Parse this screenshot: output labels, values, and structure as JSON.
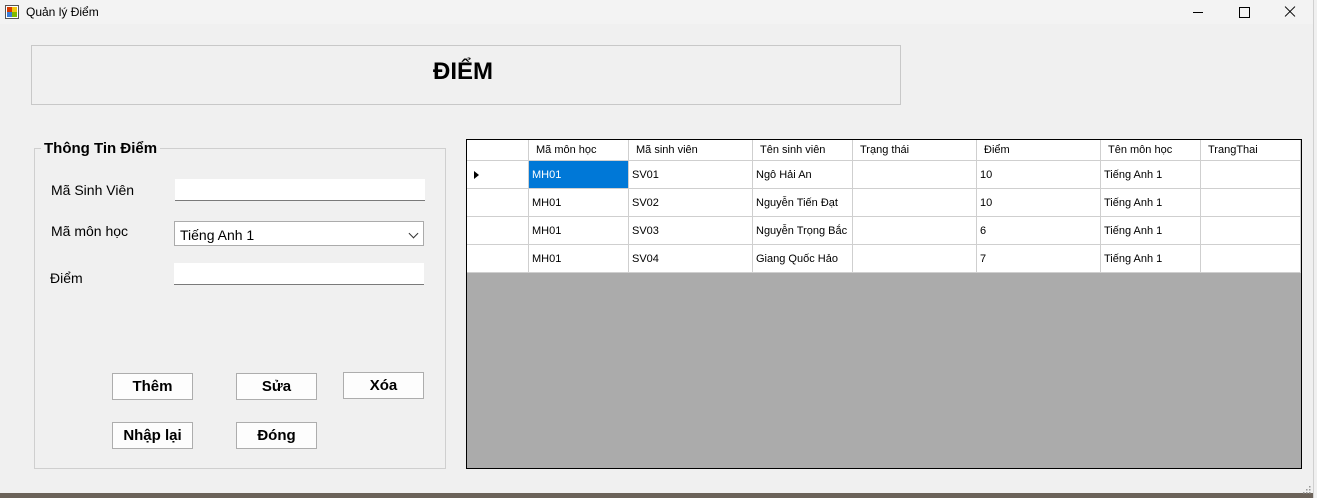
{
  "window": {
    "title": "Quản lý Điểm",
    "controls": {
      "minimize": "minimize",
      "maximize": "maximize",
      "close": "close"
    }
  },
  "header": {
    "title": "ĐIỂM"
  },
  "form": {
    "legend": "Thông Tin Điểm",
    "student_id_label": "Mã Sinh Viên",
    "student_id_value": "",
    "course_id_label": "Mã môn học",
    "course_selected": "Tiếng Anh 1",
    "score_label": "Điểm",
    "score_value": ""
  },
  "buttons": {
    "add": "Thêm",
    "edit": "Sửa",
    "delete": "Xóa",
    "reset": "Nhập lại",
    "close": "Đóng"
  },
  "grid": {
    "columns": [
      "Mã môn học",
      "Mã sinh viên",
      "Tên sinh viên",
      "Trạng thái",
      "Điểm",
      "Tên môn học",
      "TrangThai"
    ],
    "rows": [
      [
        "MH01",
        "SV01",
        "Ngô Hải An",
        "",
        "10",
        "Tiếng Anh 1",
        ""
      ],
      [
        "MH01",
        "SV02",
        "Nguyễn Tiến Đạt",
        "",
        "10",
        "Tiếng Anh 1",
        ""
      ],
      [
        "MH01",
        "SV03",
        "Nguyễn Trọng Bắc",
        "",
        "6",
        "Tiếng Anh 1",
        ""
      ],
      [
        "MH01",
        "SV04",
        "Giang Quốc Hảo",
        "",
        "7",
        "Tiếng Anh 1",
        ""
      ]
    ],
    "current_row": 0,
    "selected_cell": [
      0,
      0
    ]
  },
  "colors": {
    "selection": "#0078d7",
    "grid_background": "#ababab",
    "window_background": "#f0f0f0"
  }
}
